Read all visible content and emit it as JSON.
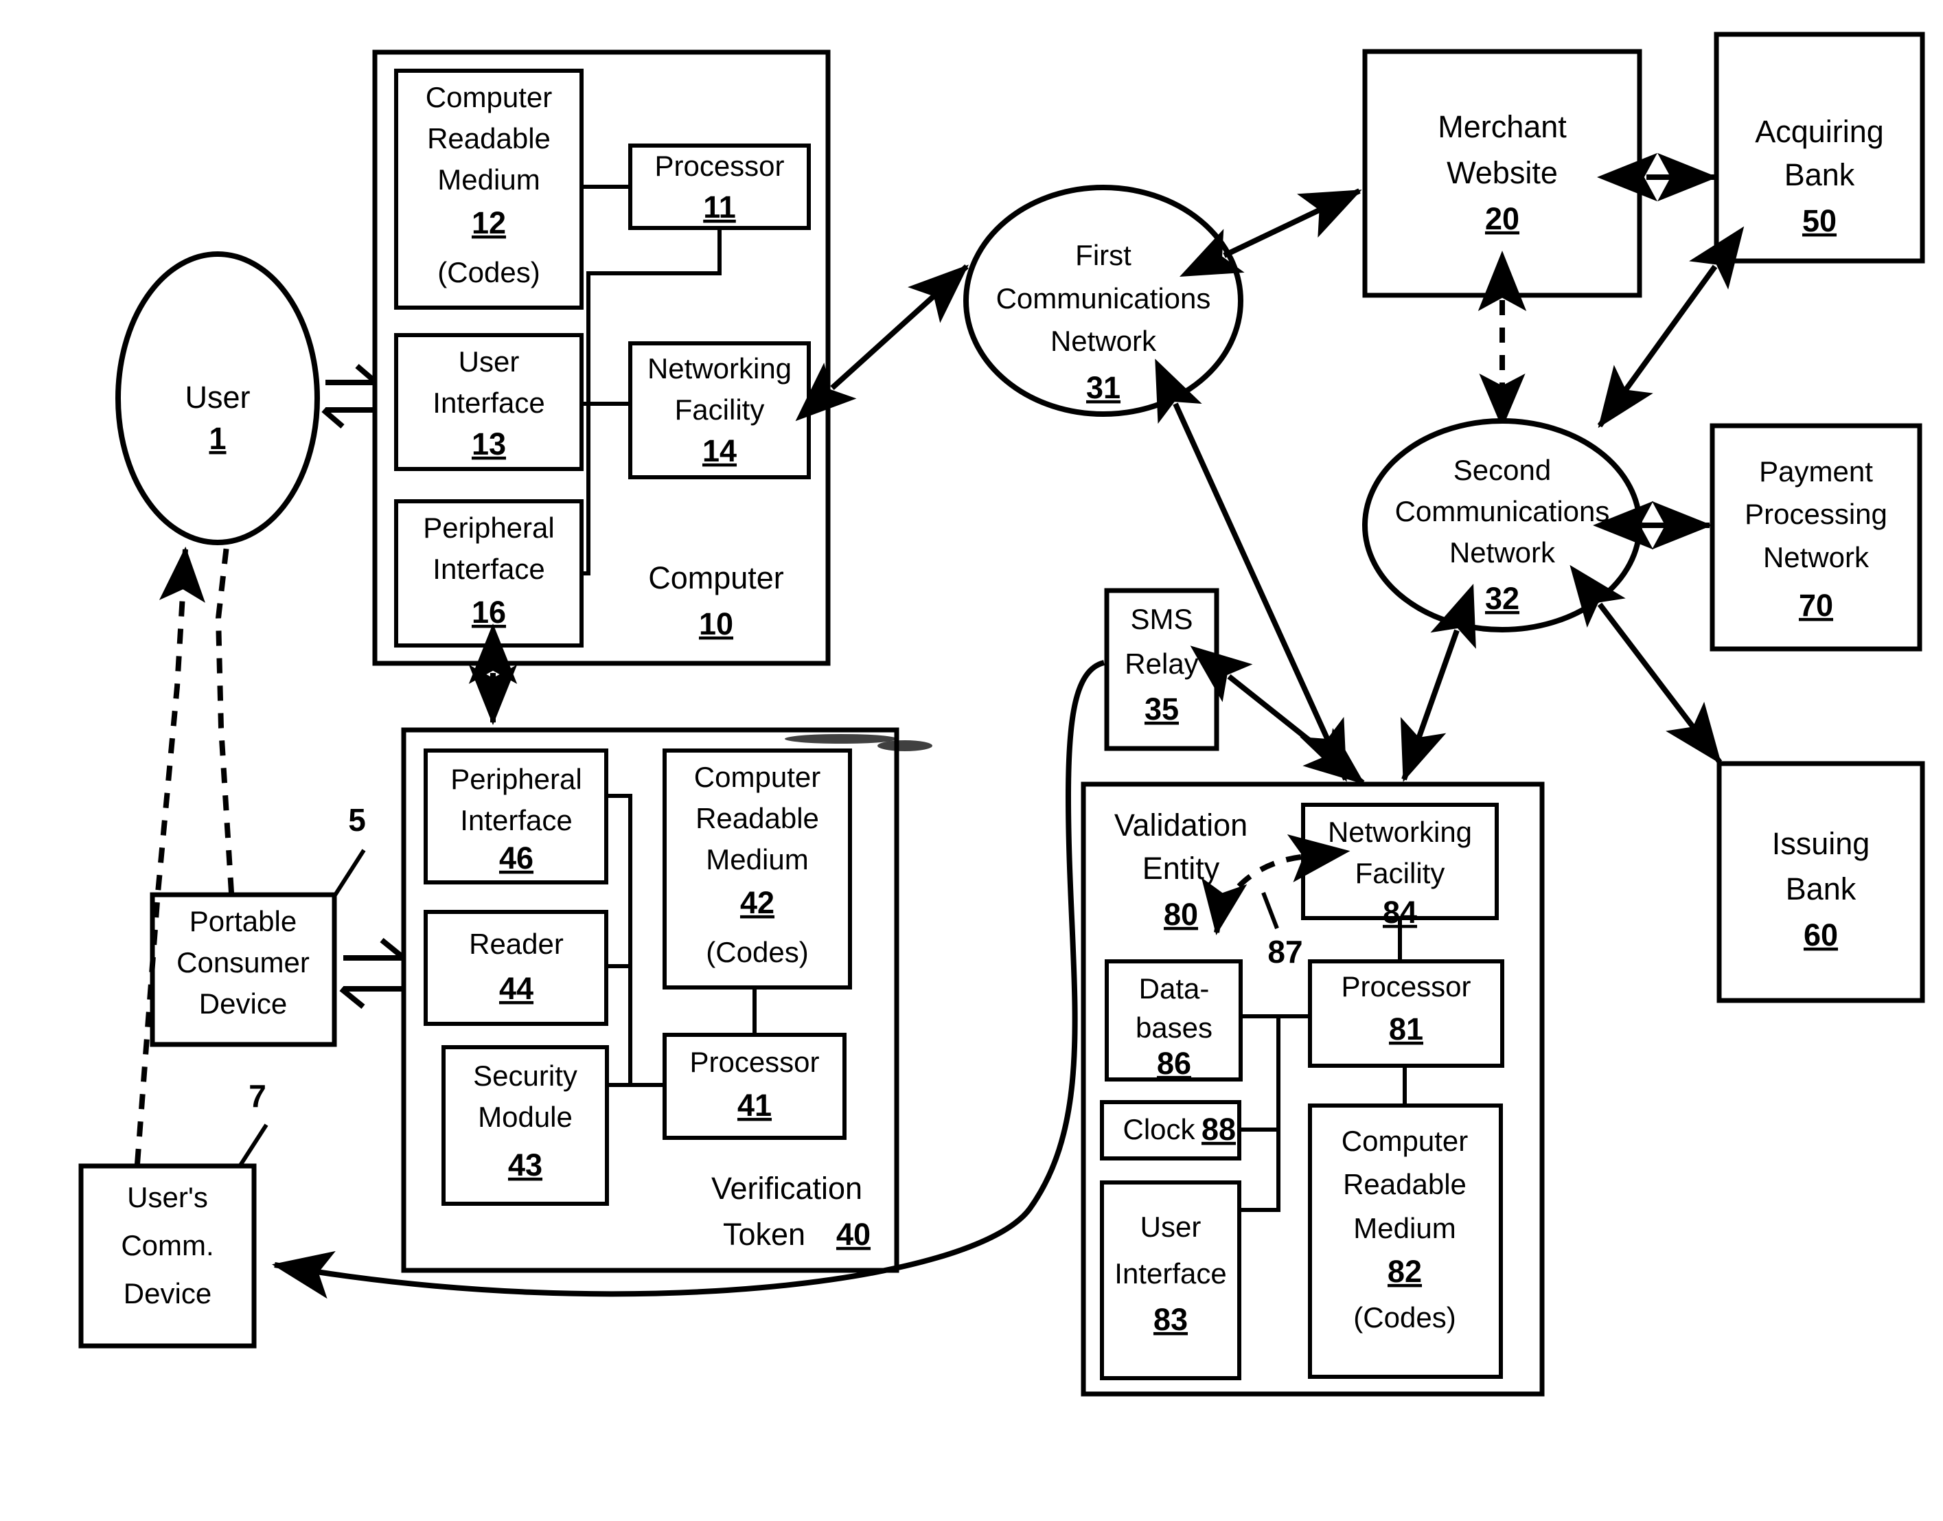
{
  "figure": {
    "title": "Payment transaction verification system block diagram",
    "entities": {
      "user": {
        "label_line1": "User",
        "number": "1"
      },
      "computer": {
        "label": "Computer",
        "number": "10",
        "crm": {
          "line1": "Computer",
          "line2": "Readable",
          "line3": "Medium",
          "number": "12",
          "note": "(Codes)"
        },
        "processor": {
          "line1": "Processor",
          "number": "11"
        },
        "user_interface": {
          "line1": "User",
          "line2": "Interface",
          "number": "13"
        },
        "networking_facility": {
          "line1": "Networking",
          "line2": "Facility",
          "number": "14"
        },
        "peripheral_interface": {
          "line1": "Peripheral",
          "line2": "Interface",
          "number": "16"
        }
      },
      "verification_token": {
        "label_line1": "Verification",
        "label_line2": "Token",
        "number": "40",
        "peripheral_interface": {
          "line1": "Peripheral",
          "line2": "Interface",
          "number": "46"
        },
        "reader": {
          "line1": "Reader",
          "number": "44"
        },
        "security_module": {
          "line1": "Security",
          "line2": "Module",
          "number": "43"
        },
        "crm": {
          "line1": "Computer",
          "line2": "Readable",
          "line3": "Medium",
          "number": "42",
          "note": "(Codes)"
        },
        "processor": {
          "line1": "Processor",
          "number": "41"
        }
      },
      "portable_consumer_device": {
        "line1": "Portable",
        "line2": "Consumer",
        "line3": "Device",
        "ref": "5"
      },
      "users_comm_device": {
        "line1": "User's",
        "line2": "Comm.",
        "line3": "Device",
        "ref": "7"
      },
      "first_network": {
        "line1": "First",
        "line2": "Communications",
        "line3": "Network",
        "number": "31"
      },
      "second_network": {
        "line1": "Second",
        "line2": "Communications",
        "line3": "Network",
        "number": "32"
      },
      "sms_relay": {
        "line1": "SMS",
        "line2": "Relay",
        "number": "35"
      },
      "merchant_website": {
        "line1": "Merchant",
        "line2": "Website",
        "number": "20"
      },
      "acquiring_bank": {
        "line1": "Acquiring",
        "line2": "Bank",
        "number": "50"
      },
      "payment_processing_network": {
        "line1": "Payment",
        "line2": "Processing",
        "line3": "Network",
        "number": "70"
      },
      "issuing_bank": {
        "line1": "Issuing",
        "line2": "Bank",
        "number": "60"
      },
      "validation_entity": {
        "label_line1": "Validation",
        "label_line2": "Entity",
        "number": "80",
        "networking_facility": {
          "line1": "Networking",
          "line2": "Facility",
          "number": "84"
        },
        "databases": {
          "line1": "Data-",
          "line2": "bases",
          "number": "86"
        },
        "processor": {
          "line1": "Processor",
          "number": "81"
        },
        "clock": {
          "line1": "Clock",
          "number": "88"
        },
        "user_interface": {
          "line1": "User",
          "line2": "Interface",
          "number": "83"
        },
        "crm": {
          "line1": "Computer",
          "line2": "Readable",
          "line3": "Medium",
          "number": "82",
          "note": "(Codes)"
        },
        "internal_ref": "87"
      }
    },
    "colors": {
      "ink": "#000000",
      "paper": "#ffffff"
    }
  }
}
